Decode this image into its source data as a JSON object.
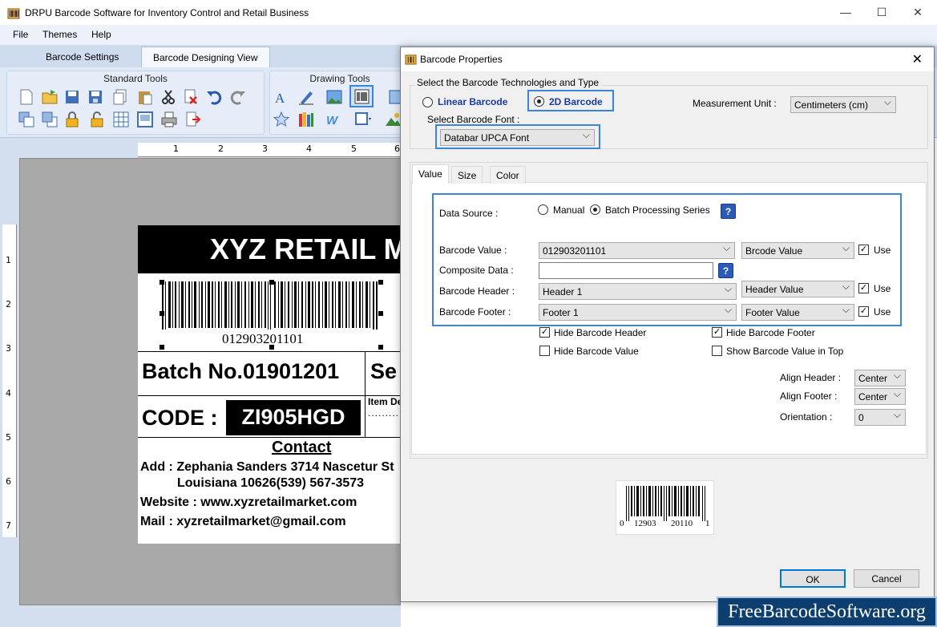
{
  "app": {
    "title": "DRPU Barcode Software for Inventory Control and Retail Business",
    "menus": [
      "File",
      "Themes",
      "Help"
    ],
    "tabs": [
      "Barcode Settings",
      "Barcode Designing View"
    ],
    "groups": {
      "standard": "Standard Tools",
      "drawing": "Drawing Tools"
    }
  },
  "rulers": {
    "top": [
      "1",
      "2",
      "3",
      "4",
      "5",
      "6"
    ],
    "left": [
      "1",
      "2",
      "3",
      "4",
      "5",
      "6",
      "7"
    ]
  },
  "label": {
    "banner": "XYZ RETAIL M",
    "barcode_digits": "012903201101",
    "batch": "Batch No.01901201",
    "se": "Se",
    "code_label": "CODE :",
    "code_value": "ZI905HGD",
    "item_de": "Item De",
    "dots": "...........",
    "contact": "Contact",
    "addr1": "Add : Zephania Sanders 3714 Nascetur St",
    "addr2": "Louisiana 10626(539) 567-3573",
    "website": "Website : www.xyzretailmarket.com",
    "mail": "Mail : xyzretailmarket@gmail.com"
  },
  "dialog": {
    "title": "Barcode Properties",
    "tech_legend": "Select the Barcode Technologies and Type",
    "linear": "Linear Barcode",
    "twod": "2D Barcode",
    "measure_label": "Measurement Unit :",
    "measure_value": "Centimeters (cm)",
    "font_label": "Select Barcode Font :",
    "font_value": "Databar UPCA Font",
    "tabs": [
      "Value",
      "Size",
      "Color"
    ],
    "data_source_label": "Data Source :",
    "manual": "Manual",
    "batch": "Batch Processing Series",
    "help": "?",
    "rows": [
      {
        "label": "Barcode Value :",
        "value": "012903201101",
        "field": "Brcode Value",
        "use": "Use"
      },
      {
        "label": "Composite Data :"
      },
      {
        "label": "Barcode Header :",
        "value": "Header 1",
        "field": "Header Value",
        "use": "Use"
      },
      {
        "label": "Barcode Footer :",
        "value": "Footer 1",
        "field": "Footer Value",
        "use": "Use"
      }
    ],
    "hide_header": "Hide Barcode Header",
    "hide_footer": "Hide Barcode Footer",
    "hide_value": "Hide Barcode Value",
    "show_top": "Show Barcode Value in Top",
    "align_header_label": "Align Header :",
    "align_header": "Center",
    "align_footer_label": "Align Footer :",
    "align_footer": "Center",
    "orientation_label": "Orientation :",
    "orientation": "0",
    "preview": {
      "d0": "0",
      "d1": "12903",
      "d2": "20110",
      "d3": "1"
    },
    "ok": "OK",
    "cancel": "Cancel"
  },
  "watermark": "FreeBarcodeSoftware.org"
}
